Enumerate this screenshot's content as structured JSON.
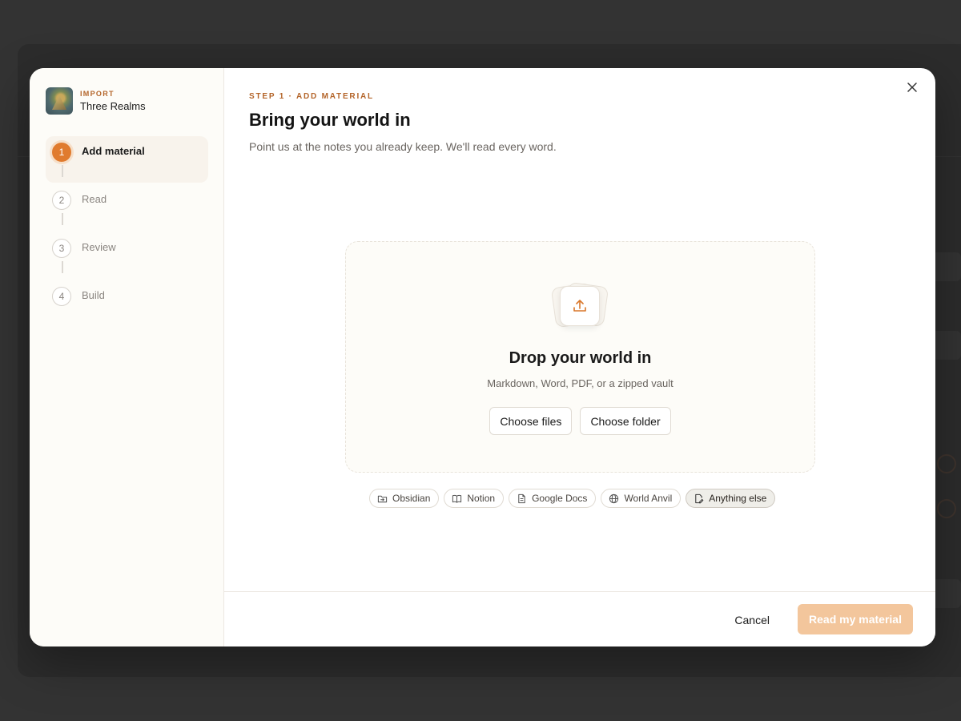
{
  "project": {
    "eyebrow": "IMPORT",
    "name": "Three Realms"
  },
  "steps": [
    {
      "number": "1",
      "label": "Add material",
      "state": "active"
    },
    {
      "number": "2",
      "label": "Read",
      "state": "pending"
    },
    {
      "number": "3",
      "label": "Review",
      "state": "pending"
    },
    {
      "number": "4",
      "label": "Build",
      "state": "pending"
    }
  ],
  "header": {
    "eyebrow": "STEP 1 · ADD MATERIAL",
    "title": "Bring your world in",
    "subtitle": "Point us at the notes you already keep. We'll read every word.",
    "close_icon": "close-icon"
  },
  "dropzone": {
    "icon": "upload-icon",
    "title": "Drop your world in",
    "subtitle": "Markdown, Word, PDF, or a zipped vault",
    "choose_files_label": "Choose files",
    "choose_folder_label": "Choose folder"
  },
  "sources": [
    {
      "label": "Obsidian",
      "icon": "folder-import-icon",
      "selected": false
    },
    {
      "label": "Notion",
      "icon": "book-icon",
      "selected": false
    },
    {
      "label": "Google Docs",
      "icon": "document-icon",
      "selected": false
    },
    {
      "label": "World Anvil",
      "icon": "globe-icon",
      "selected": false
    },
    {
      "label": "Anything else",
      "icon": "file-edit-icon",
      "selected": true
    }
  ],
  "footer": {
    "cancel_label": "Cancel",
    "primary_label": "Read my material"
  },
  "colors": {
    "accent": "#e07b2e",
    "accent_text": "#b4652a",
    "primary_disabled": "#f3c69c"
  }
}
